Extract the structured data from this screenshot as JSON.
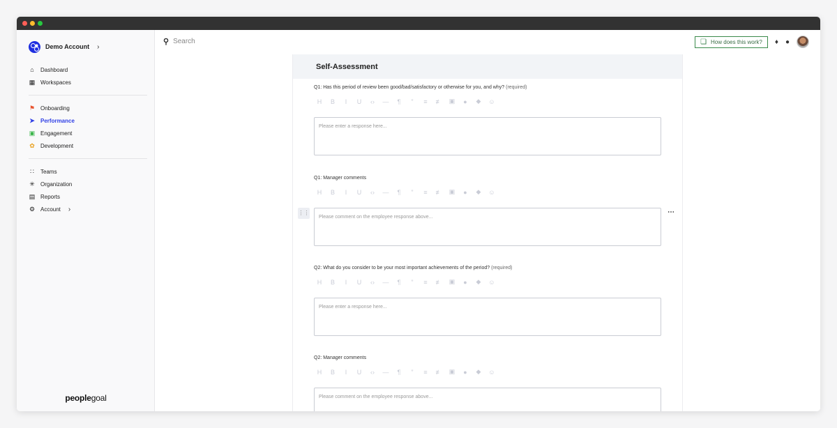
{
  "account": {
    "name": "Demo Account"
  },
  "nav_main": [
    {
      "label": "Dashboard",
      "icon": "home-icon"
    },
    {
      "label": "Workspaces",
      "icon": "grid-icon"
    }
  ],
  "nav_modules": [
    {
      "label": "Onboarding",
      "icon": "flag-icon"
    },
    {
      "label": "Performance",
      "icon": "paper-plane-icon"
    },
    {
      "label": "Engagement",
      "icon": "puzzle-icon"
    },
    {
      "label": "Development",
      "icon": "sprout-icon"
    }
  ],
  "nav_admin": [
    {
      "label": "Teams",
      "icon": "org-chart-icon"
    },
    {
      "label": "Organization",
      "icon": "network-icon"
    },
    {
      "label": "Reports",
      "icon": "report-icon"
    },
    {
      "label": "Account",
      "icon": "gear-icon"
    }
  ],
  "brand": {
    "bold": "people",
    "light": "goal"
  },
  "search": {
    "placeholder": "Search"
  },
  "help": {
    "label": "How does this work?"
  },
  "section": {
    "title": "Self-Assessment"
  },
  "required_label": "(required)",
  "questions": [
    {
      "label": "Q1: Has this period of review been good/bad/satisfactory or otherwise for you, and why?",
      "required": true,
      "placeholder": "Please enter a response here..."
    },
    {
      "label": "Q1: Manager comments",
      "required": false,
      "placeholder": "Please comment on the employee response above..."
    },
    {
      "label": "Q2: What do you consider to be your most important achievements of the period?",
      "required": true,
      "placeholder": "Please enter a response here..."
    },
    {
      "label": "Q2: Manager comments",
      "required": false,
      "placeholder": "Please comment on the employee response above..."
    }
  ],
  "colors": {
    "accent": "#2f3fe6",
    "help_border": "#3a8a4a",
    "onboarding": "#e8542f",
    "engagement": "#3bb54a",
    "development": "#e8a020"
  }
}
